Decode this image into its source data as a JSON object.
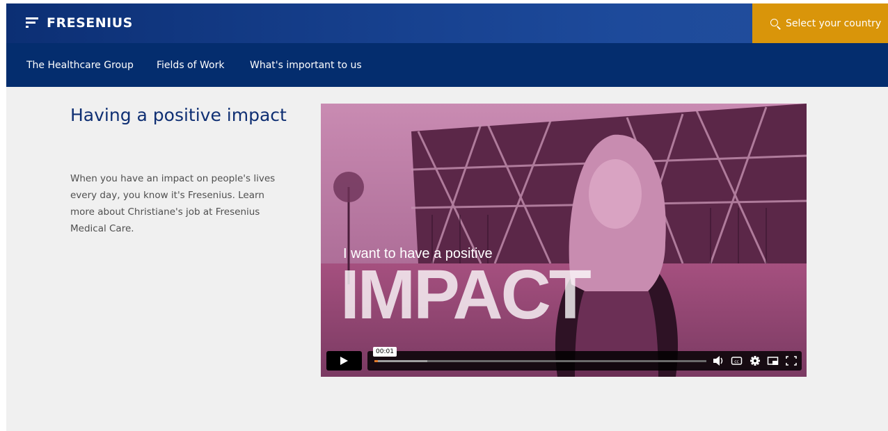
{
  "header": {
    "logo_text": "FRESENIUS",
    "country_button": {
      "label": "Select your country",
      "icon": "search-icon"
    },
    "accent_color": "#d9950a",
    "brand_color": "#0c2f74"
  },
  "nav": {
    "items": [
      {
        "label": "The Healthcare Group"
      },
      {
        "label": "Fields of Work"
      },
      {
        "label": "What's important to us"
      }
    ]
  },
  "main": {
    "heading": "Having a positive impact",
    "body": "When you have an impact on people's lives every day, you know it's Fresenius. Learn more about Christiane's job at Fresenius Medical Care."
  },
  "video": {
    "caption_small": "I want to have a positive",
    "caption_big": "IMPACT",
    "current_time": "00:01",
    "played_fraction": 0.01,
    "buffered_fraction": 0.16,
    "icons": [
      "play-icon",
      "volume-icon",
      "captions-icon",
      "settings-icon",
      "picture-in-picture-icon",
      "fullscreen-icon"
    ]
  }
}
